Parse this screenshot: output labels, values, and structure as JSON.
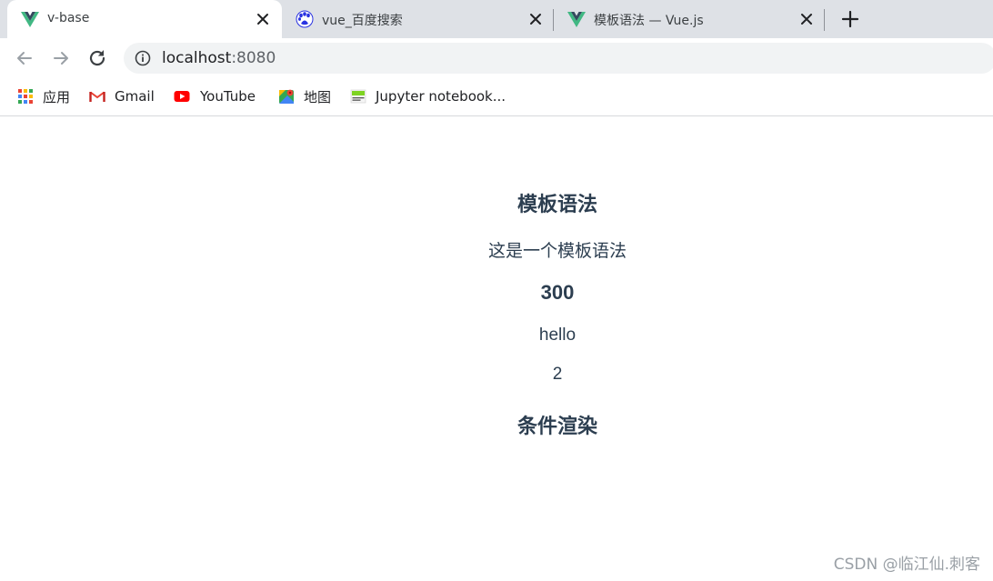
{
  "tabs": [
    {
      "title": "v-base",
      "favicon": "vue-logo-icon",
      "active": true
    },
    {
      "title": "vue_百度搜索",
      "favicon": "baidu-paw-icon",
      "active": false
    },
    {
      "title": "模板语法 — Vue.js",
      "favicon": "vue-logo-icon",
      "active": false
    }
  ],
  "toolbar": {
    "url_host": "localhost",
    "url_port": ":8080"
  },
  "bookmarks": [
    {
      "label": "应用",
      "icon": "apps-grid-icon"
    },
    {
      "label": "Gmail",
      "icon": "gmail-icon"
    },
    {
      "label": "YouTube",
      "icon": "youtube-icon"
    },
    {
      "label": "地图",
      "icon": "maps-icon"
    },
    {
      "label": "Jupyter notebook...",
      "icon": "jupyter-icon"
    }
  ],
  "page": {
    "heading_template": "模板语法",
    "message": "这是一个模板语法",
    "number_value": "300",
    "hello_text": "hello",
    "count_value": "2",
    "heading_condition": "条件渲染"
  },
  "watermark": "CSDN @临江仙.刺客",
  "colors": {
    "tabstrip": "#dee1e6",
    "vue_green": "#41b883",
    "vue_dark": "#35495e",
    "content_text": "#2c3e50"
  }
}
